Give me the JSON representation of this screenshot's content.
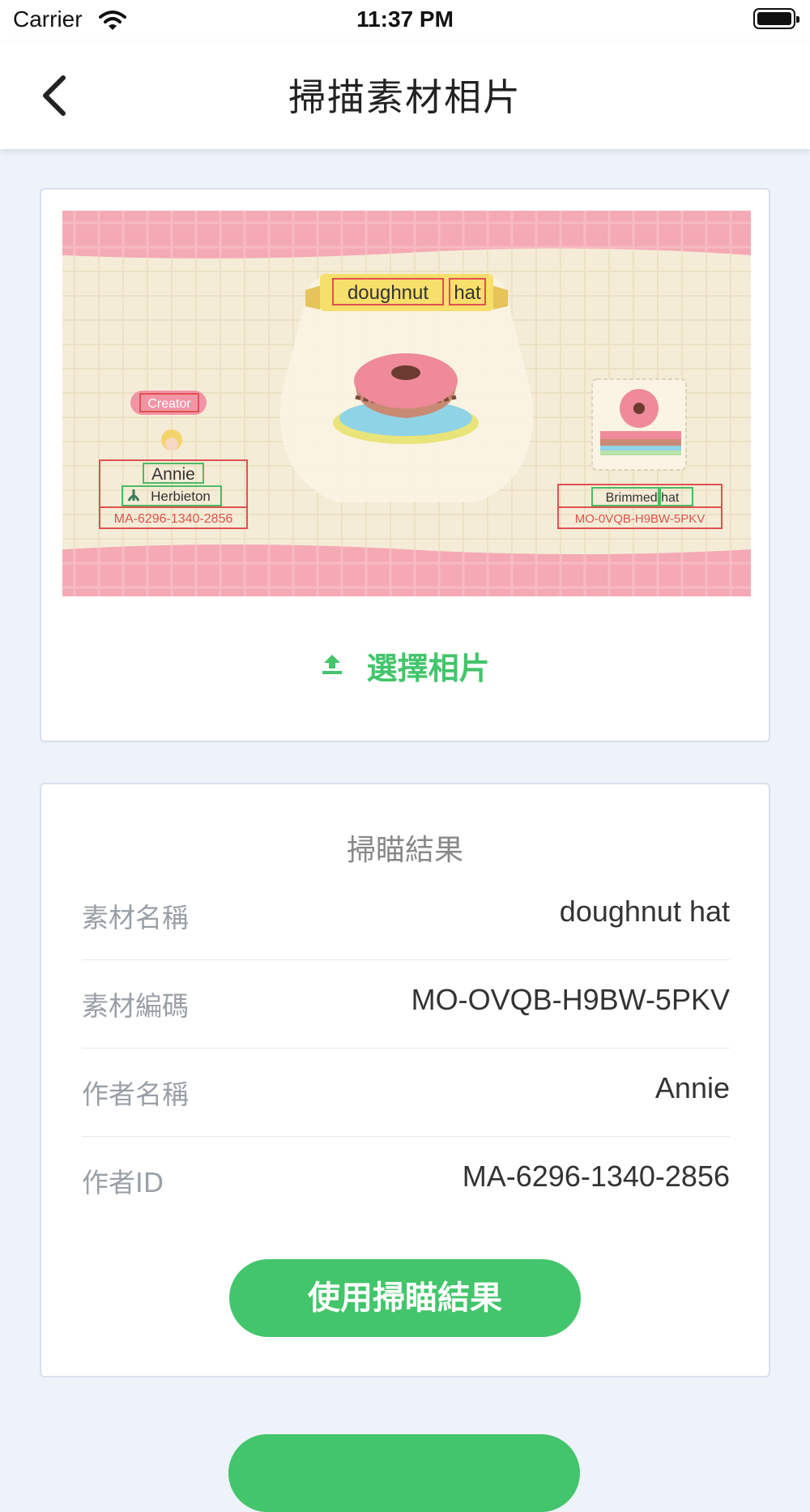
{
  "status_bar": {
    "carrier": "Carrier",
    "time": "11:37 PM"
  },
  "nav": {
    "title": "掃描素材相片",
    "back_icon": "chevron-left-icon"
  },
  "photo_card": {
    "choose_label": "選擇相片",
    "upload_icon": "upload-icon",
    "photo_labels": {
      "item_name_word1": "doughnut",
      "item_name_word2": "hat",
      "creator_badge": "Creator",
      "creator_name": "Annie",
      "island": "Herbieton",
      "creator_id": "MA-6296-1340-2856",
      "item_type": "Brimmed hat",
      "item_code": "MO-0VQB-H9BW-5PKV"
    }
  },
  "result_card": {
    "title": "掃瞄結果",
    "rows": [
      {
        "key": "素材名稱",
        "value": "doughnut hat"
      },
      {
        "key": "素材編碼",
        "value": "MO-OVQB-H9BW-5PKV"
      },
      {
        "key": "作者名稱",
        "value": "Annie"
      },
      {
        "key": "作者ID",
        "value": "MA-6296-1340-2856"
      }
    ],
    "use_button_label": "使用掃瞄結果"
  },
  "colors": {
    "accent": "#43c56b",
    "background": "#eef2f9",
    "card_border": "#d9e0ec"
  }
}
